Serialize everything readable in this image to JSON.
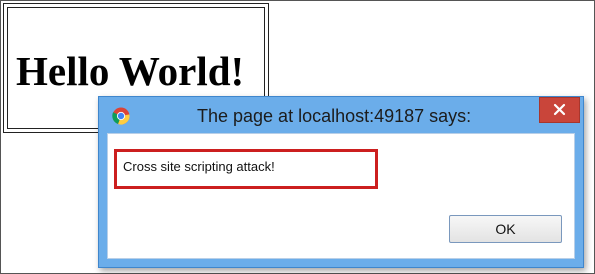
{
  "page": {
    "heading": "Hello World!"
  },
  "dialog": {
    "title": "The page at localhost:49187 says:",
    "message": "Cross site scripting attack!",
    "ok_label": "OK",
    "close_icon": "close-icon",
    "app_icon": "chrome-icon",
    "titlebar_color": "#6badea",
    "close_button_color": "#c9453a",
    "highlight_color": "#cc1f1f"
  }
}
